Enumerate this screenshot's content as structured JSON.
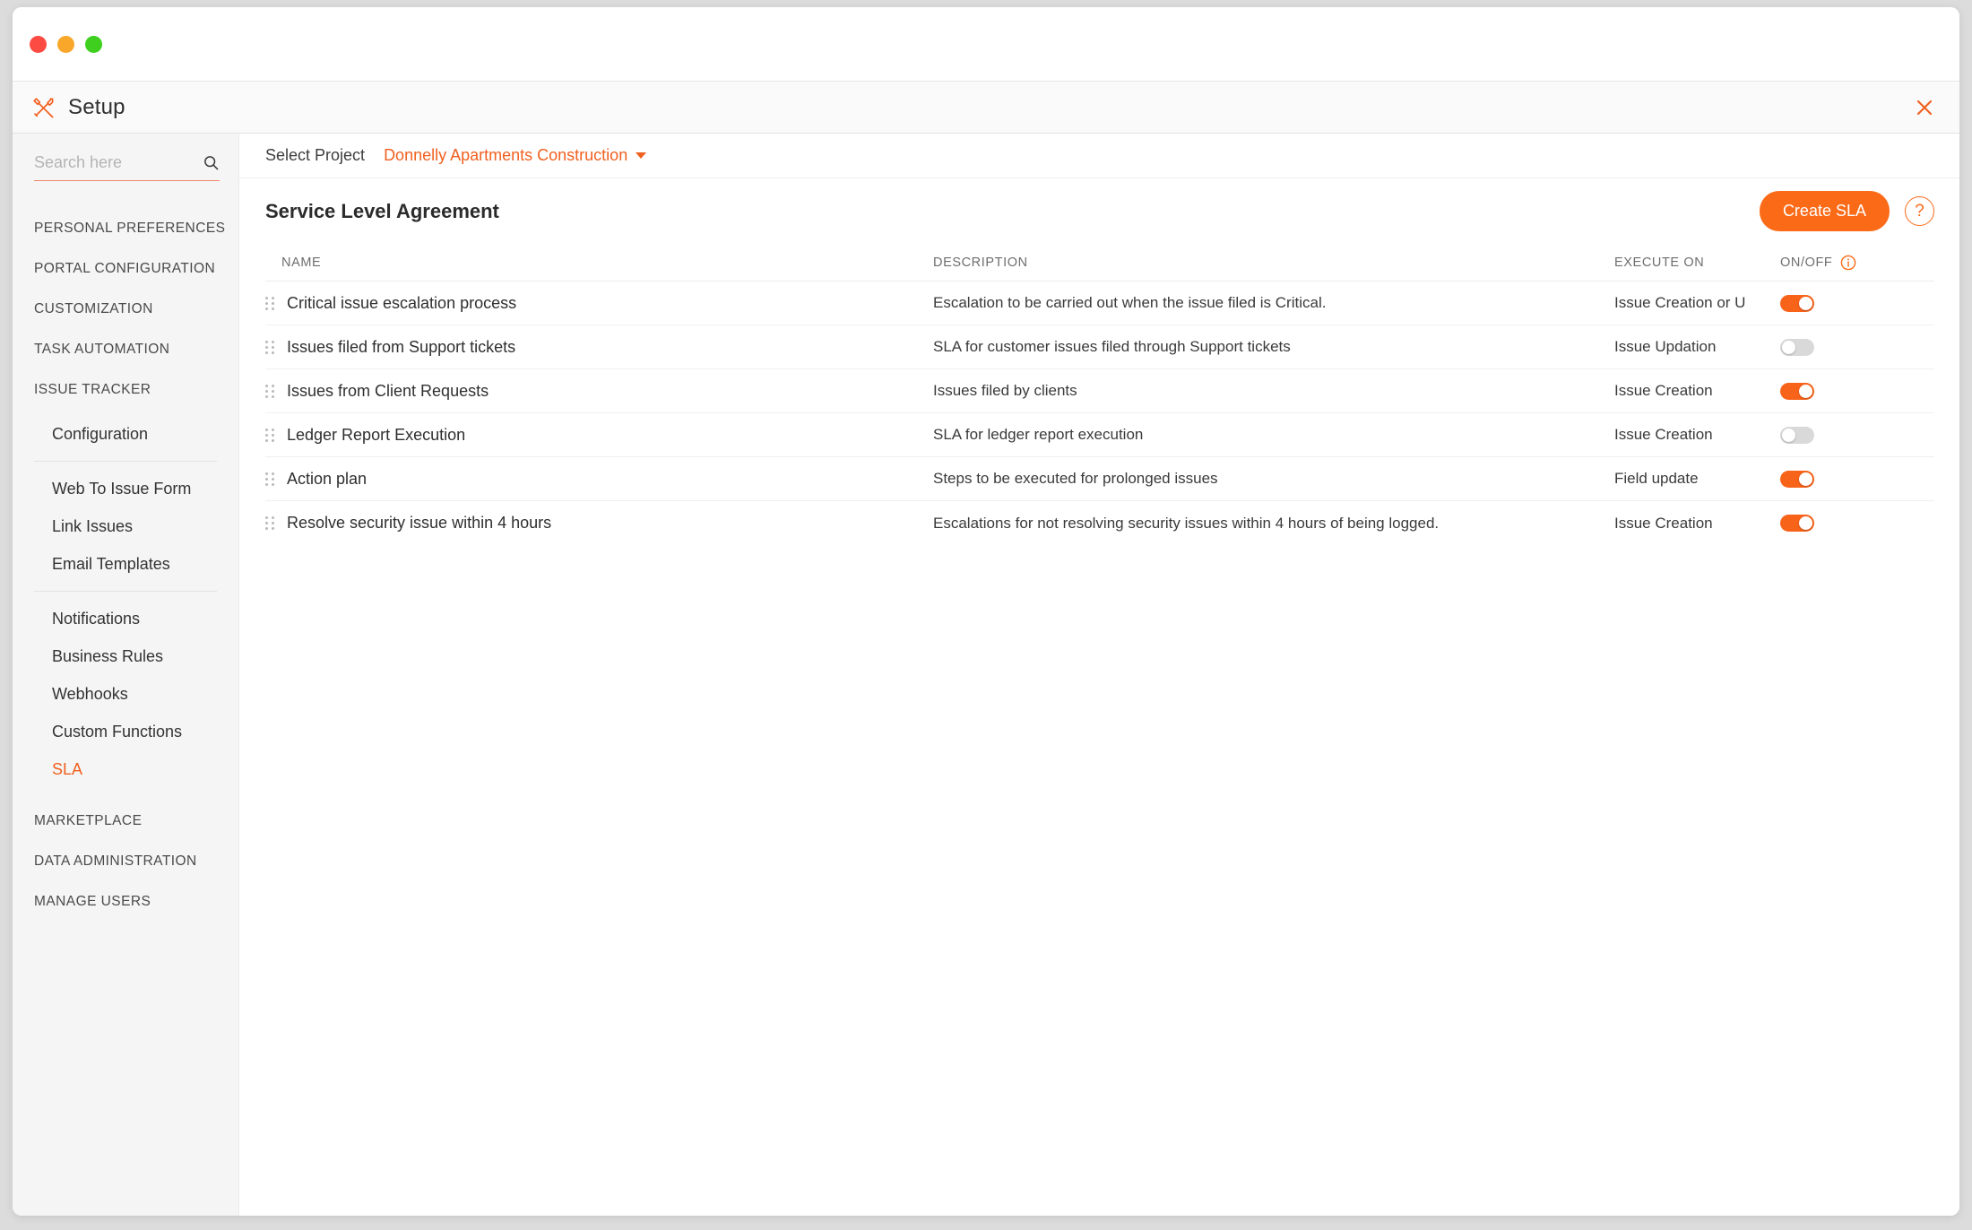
{
  "window": {
    "traffic_lights": [
      "close",
      "minimize",
      "maximize"
    ],
    "accent_color": "#f0601f",
    "toggle_on_color": "#f8631a",
    "toggle_off_color": "#d9d9d9"
  },
  "header": {
    "title": "Setup",
    "icon": "tools-icon",
    "close_icon": "close-icon"
  },
  "sidebar": {
    "search": {
      "placeholder": "Search here",
      "value": "",
      "icon": "search-icon"
    },
    "items": [
      {
        "label": "PERSONAL PREFERENCES",
        "type": "section"
      },
      {
        "label": "PORTAL CONFIGURATION",
        "type": "section"
      },
      {
        "label": "CUSTOMIZATION",
        "type": "section"
      },
      {
        "label": "TASK AUTOMATION",
        "type": "section"
      },
      {
        "label": "ISSUE TRACKER",
        "type": "section"
      },
      {
        "label": "Configuration",
        "type": "item"
      },
      {
        "label": "Web To Issue Form",
        "type": "item"
      },
      {
        "label": "Link Issues",
        "type": "item"
      },
      {
        "label": "Email Templates",
        "type": "item"
      },
      {
        "label": "Notifications",
        "type": "item"
      },
      {
        "label": "Business Rules",
        "type": "item"
      },
      {
        "label": "Webhooks",
        "type": "item"
      },
      {
        "label": "Custom Functions",
        "type": "item"
      },
      {
        "label": "SLA",
        "type": "item",
        "active": true
      },
      {
        "label": "MARKETPLACE",
        "type": "section"
      },
      {
        "label": "DATA ADMINISTRATION",
        "type": "section"
      },
      {
        "label": "MANAGE USERS",
        "type": "section"
      }
    ]
  },
  "project_bar": {
    "label": "Select Project",
    "selected": "Donnelly Apartments Construction",
    "caret_icon": "chevron-down-icon"
  },
  "page": {
    "title": "Service Level Agreement",
    "create_button": "Create SLA",
    "help_button": "?"
  },
  "table": {
    "columns": {
      "name": "NAME",
      "description": "DESCRIPTION",
      "execute_on": "EXECUTE ON",
      "on_off": "ON/OFF",
      "on_off_info_icon": "info-icon"
    },
    "rows": [
      {
        "name": "Critical issue escalation process",
        "description": "Escalation to be carried out when the issue filed is Critical.",
        "execute_on": "Issue Creation or U",
        "enabled": true
      },
      {
        "name": "Issues filed from Support tickets",
        "description": "SLA for customer issues filed through Support tickets",
        "execute_on": "Issue Updation",
        "enabled": false
      },
      {
        "name": "Issues from Client Requests",
        "description": "Issues filed by clients",
        "execute_on": "Issue Creation",
        "enabled": true
      },
      {
        "name": "Ledger Report Execution",
        "description": "SLA for ledger report execution",
        "execute_on": "Issue Creation",
        "enabled": false
      },
      {
        "name": "Action plan",
        "description": "Steps to be executed for prolonged issues",
        "execute_on": "Field update",
        "enabled": true
      },
      {
        "name": "Resolve security issue within 4 hours",
        "description": "Escalations for not resolving security issues within 4 hours of being logged.",
        "execute_on": "Issue Creation",
        "enabled": true
      }
    ]
  }
}
